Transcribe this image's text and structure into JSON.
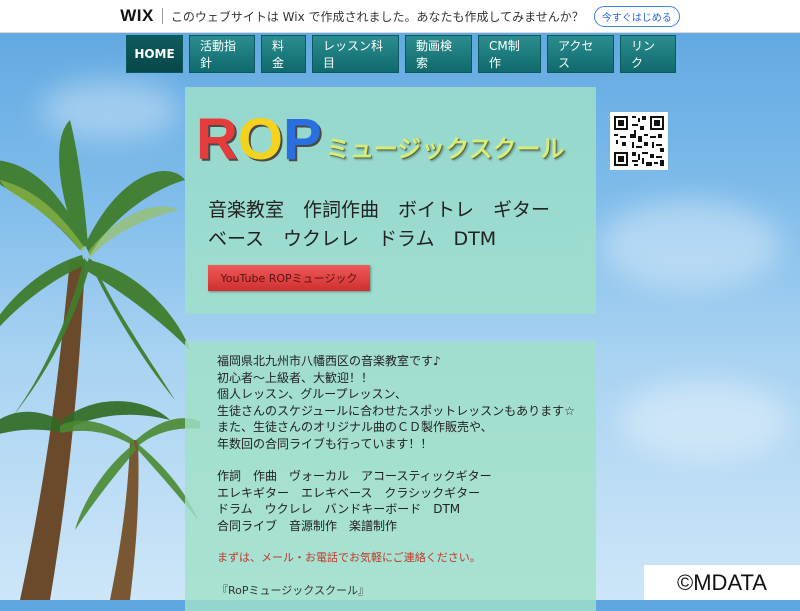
{
  "wix_banner": {
    "logo": "WIX",
    "message": "このウェブサイトは Wix で作成されました。あなたも作成してみませんか？",
    "button": "今すぐはじめる"
  },
  "nav": {
    "items": [
      "HOME",
      "活動指針",
      "料金",
      "レッスン科目",
      "動画検索",
      "CM制作",
      "アクセス",
      "リンク"
    ],
    "active_index": 0
  },
  "logo": {
    "r": "R",
    "o": "O",
    "p": "P",
    "subtitle": "ミュージックスクール"
  },
  "tags": {
    "line1": "音楽教室　作詞作曲　ボイトレ　ギター",
    "line2": "ベース　ウクレレ　ドラム　DTM"
  },
  "youtube_button": "YouTube ROPミュージック",
  "qr_icon": "qr-code-icon",
  "body": {
    "paragraph1": [
      "福岡県北九州市八幡西区の音楽教室です♪",
      "初心者～上級者、大歓迎！！",
      "個人レッスン、グループレッスン、",
      "生徒さんのスケジュールに合わせたスポットレッスンもあります☆",
      "また、生徒さんのオリジナル曲のＣＤ製作販売や、",
      "年数回の合同ライブも行っています！！"
    ],
    "paragraph2": [
      "作詞　作曲　ヴォーカル　アコースティックギター",
      "エレキギター　エレキベース　クラシックギター",
      "ドラム　ウクレレ　バンドキーボード　DTM",
      "合同ライブ　音源制作　楽譜制作"
    ],
    "contact": "まずは、メール・お電話でお気軽にご連絡ください。",
    "school": "『RoPミュージックスクール』"
  },
  "copyright": "©MDATA",
  "colors": {
    "nav": "#0f6a6d",
    "panel": "#a0e0c8",
    "button_red": "#cf2f2f"
  }
}
